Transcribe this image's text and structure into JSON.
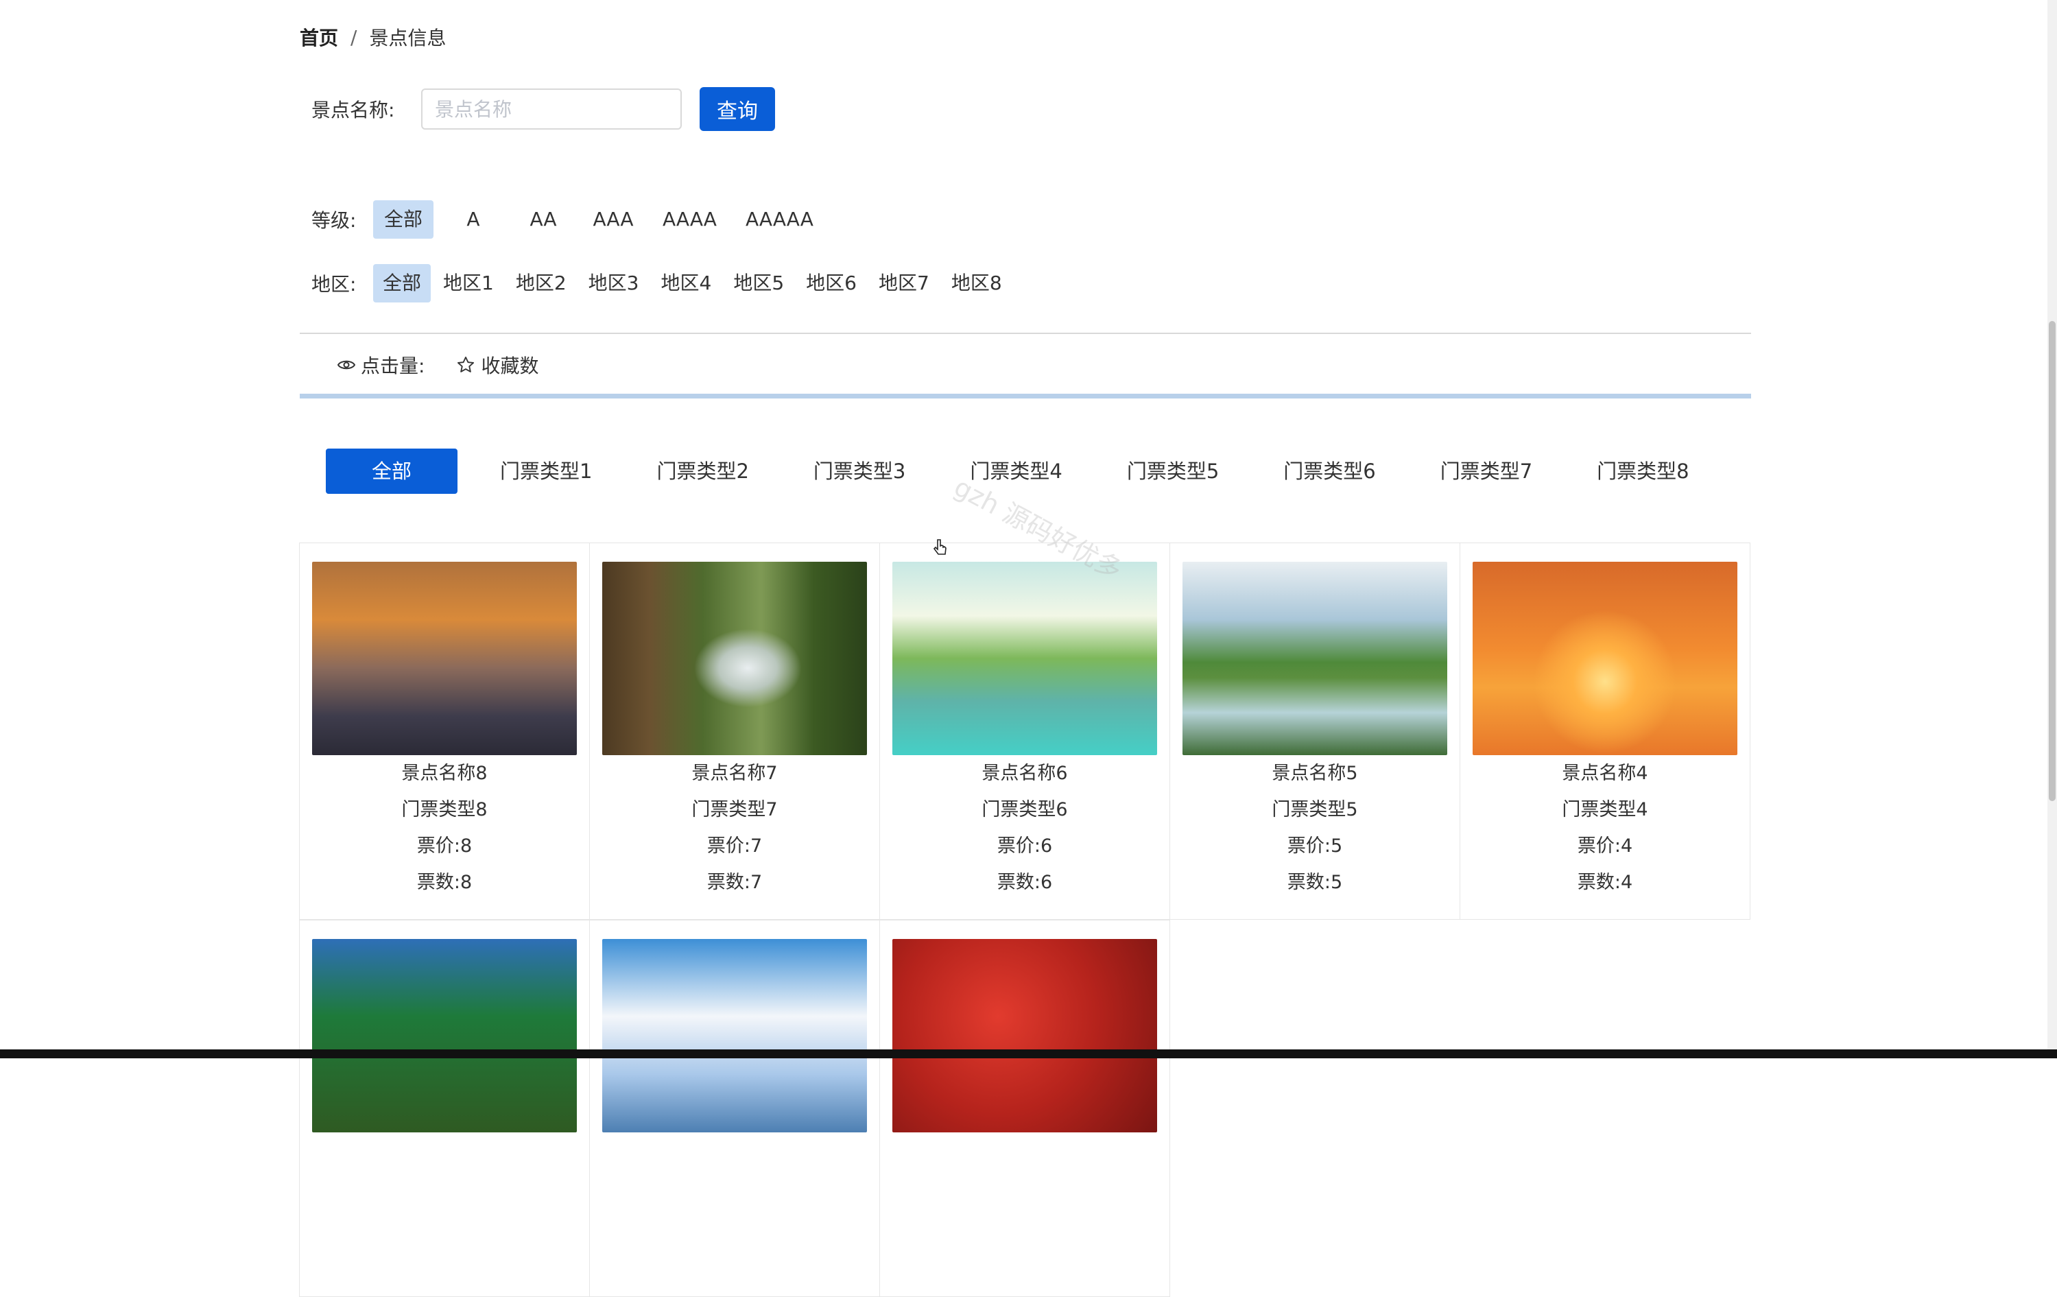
{
  "breadcrumb": {
    "home": "首页",
    "separator": "/",
    "current": "景点信息"
  },
  "search": {
    "label": "景点名称:",
    "placeholder": "景点名称",
    "value": "",
    "button": "查询"
  },
  "filters": {
    "level": {
      "label": "等级:",
      "options": [
        "全部",
        "A",
        "AA",
        "AAA",
        "AAAA",
        "AAAAA"
      ],
      "selected": "全部"
    },
    "area": {
      "label": "地区:",
      "options": [
        "全部",
        "地区1",
        "地区2",
        "地区3",
        "地区4",
        "地区5",
        "地区6",
        "地区7",
        "地区8"
      ],
      "selected": "全部"
    }
  },
  "sort": {
    "clicks_label": "点击量:",
    "favorites_label": "收藏数"
  },
  "ticket_tabs": [
    "全部",
    "门票类型1",
    "门票类型2",
    "门票类型3",
    "门票类型4",
    "门票类型5",
    "门票类型6",
    "门票类型7",
    "门票类型8"
  ],
  "selected_tab": "全部",
  "watermark": "gzh 源码好优多",
  "cards": [
    {
      "name": "景点名称8",
      "ticket_type": "门票类型8",
      "price": "票价:8",
      "count": "票数:8",
      "image": "sunset-clouds"
    },
    {
      "name": "景点名称7",
      "ticket_type": "门票类型7",
      "price": "票价:7",
      "count": "票数:7",
      "image": "forest-waterfall"
    },
    {
      "name": "景点名称6",
      "ticket_type": "门票类型6",
      "price": "票价:6",
      "count": "票数:6",
      "image": "lagoon-boats"
    },
    {
      "name": "景点名称5",
      "ticket_type": "门票类型5",
      "price": "票价:5",
      "count": "票数:5",
      "image": "karst-river"
    },
    {
      "name": "景点名称4",
      "ticket_type": "门票类型4",
      "price": "票价:4",
      "count": "票数:4",
      "image": "sunset-lake-boat"
    },
    {
      "image": "palm-trees"
    },
    {
      "image": "blue-sky-clouds"
    },
    {
      "image": "red-maple"
    }
  ],
  "colors": {
    "primary": "#0a5ed7",
    "active_filter_bg": "#c8ddf5",
    "accent_line": "#b8d0ea"
  }
}
